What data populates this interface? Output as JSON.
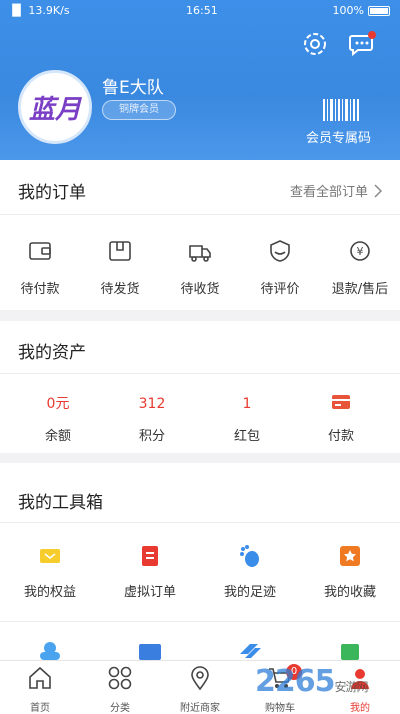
{
  "status_bar": {
    "signal_left": "▐▌ 13.9K/s",
    "time": "16:51",
    "battery": "100%"
  },
  "header": {
    "username": "鲁E大队",
    "member_badge": "铜牌会员",
    "member_code_label": "会员专属码"
  },
  "orders": {
    "title": "我的订单",
    "view_all": "查看全部订单",
    "items": [
      {
        "label": "待付款",
        "icon": "wallet-icon"
      },
      {
        "label": "待发货",
        "icon": "package-icon"
      },
      {
        "label": "待收货",
        "icon": "truck-icon"
      },
      {
        "label": "待评价",
        "icon": "review-icon"
      },
      {
        "label": "退款/售后",
        "icon": "refund-icon"
      }
    ]
  },
  "assets": {
    "title": "我的资产",
    "items": [
      {
        "value": "0元",
        "label": "余额"
      },
      {
        "value": "312",
        "label": "积分"
      },
      {
        "value": "1",
        "label": "红包"
      },
      {
        "value": "",
        "label": "付款",
        "icon": "card-icon"
      }
    ]
  },
  "tools": {
    "title": "我的工具箱",
    "items": [
      {
        "label": "我的权益",
        "icon": "benefits-icon"
      },
      {
        "label": "虚拟订单",
        "icon": "virtual-order-icon"
      },
      {
        "label": "我的足迹",
        "icon": "footprint-icon"
      },
      {
        "label": "我的收藏",
        "icon": "favorites-icon"
      }
    ]
  },
  "nav": {
    "items": [
      {
        "label": "首页",
        "icon": "home-icon"
      },
      {
        "label": "分类",
        "icon": "category-icon"
      },
      {
        "label": "附近商家",
        "icon": "location-icon"
      },
      {
        "label": "购物车",
        "icon": "cart-icon",
        "badge": "0"
      },
      {
        "label": "我的",
        "icon": "profile-icon"
      }
    ]
  },
  "watermark": {
    "text": "2265",
    "suffix": "安游网"
  },
  "colors": {
    "header_blue": "#3d8fe8",
    "accent_red": "#e83a30"
  }
}
